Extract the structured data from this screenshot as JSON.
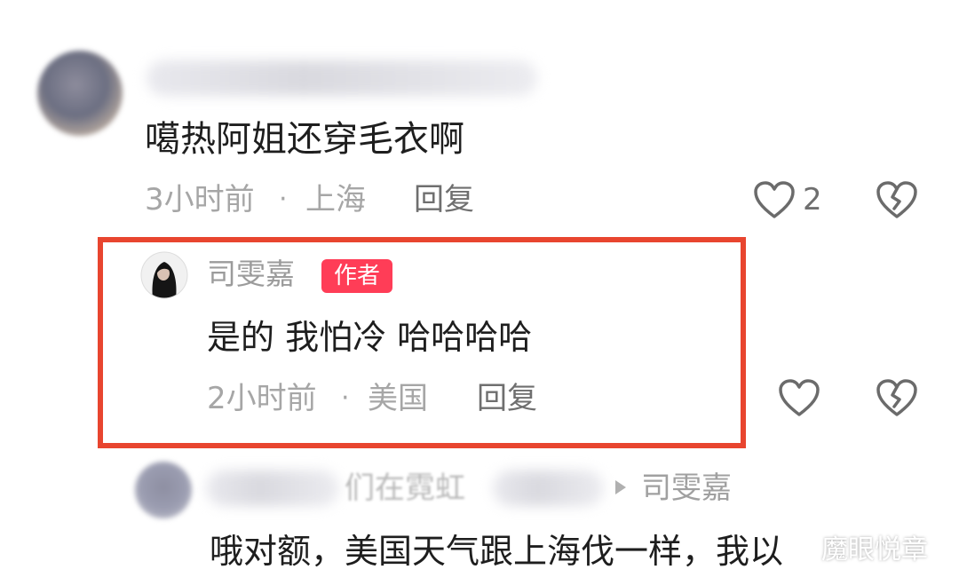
{
  "comment1": {
    "text": "噶热阿姐还穿毛衣啊",
    "time": "3小时前",
    "separator": "·",
    "location": "上海",
    "reply_label": "回复",
    "like_count": "2",
    "like_icon": "heart-outline-icon",
    "dislike_icon": "broken-heart-icon"
  },
  "comment2": {
    "author": "司雯嘉",
    "badge": "作者",
    "text": "是的 我怕冷 哈哈哈哈",
    "time": "2小时前",
    "separator": "·",
    "location": "美国",
    "reply_label": "回复",
    "like_icon": "heart-outline-icon",
    "dislike_icon": "broken-heart-icon"
  },
  "comment3": {
    "name_fragment": "们在霓虹",
    "reply_to": "司雯嘉",
    "text": "哦对额，美国天气跟上海伐一样，我以"
  },
  "watermark": "魔眼悦章",
  "colors": {
    "highlight_border": "#e8452f",
    "author_badge": "#ff3d57",
    "meta_text": "#a6a6a6",
    "main_text": "#1e1e1e"
  }
}
